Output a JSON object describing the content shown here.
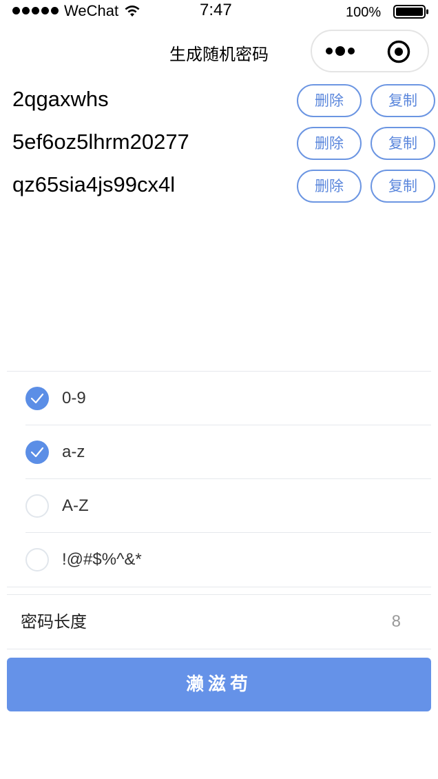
{
  "status_bar": {
    "carrier": "WeChat",
    "time": "7:47",
    "battery": "100%"
  },
  "nav": {
    "title": "生成随机密码"
  },
  "passwords": [
    {
      "value": "2qgaxwhs",
      "delete_label": "删除",
      "copy_label": "复制"
    },
    {
      "value": "5ef6oz5lhrm20277",
      "delete_label": "删除",
      "copy_label": "复制"
    },
    {
      "value": "qz65sia4js99cx4l",
      "delete_label": "删除",
      "copy_label": "复制"
    }
  ],
  "options": [
    {
      "label": "0-9",
      "checked": true
    },
    {
      "label": "a-z",
      "checked": true
    },
    {
      "label": "A-Z",
      "checked": false
    },
    {
      "label": "!@#$%^&*",
      "checked": false
    }
  ],
  "length": {
    "label": "密码长度",
    "value": "8"
  },
  "generate_button": {
    "label": "濑滋苟"
  },
  "colors": {
    "accent": "#5b8ee6",
    "button_border": "#6b95e2",
    "divider": "#e5e8ec"
  }
}
